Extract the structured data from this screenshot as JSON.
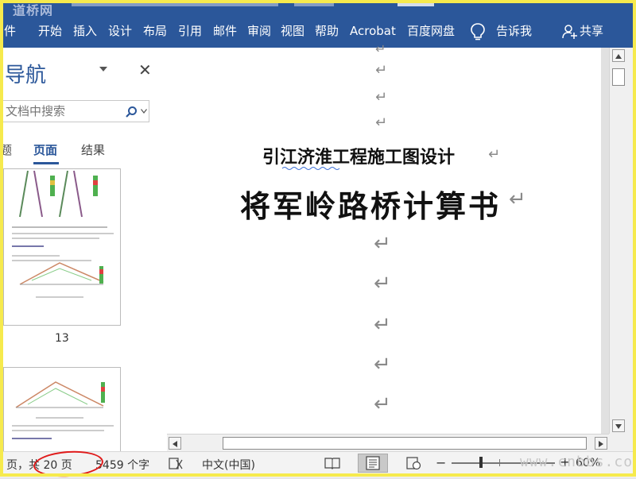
{
  "watermark": "道桥网",
  "ribbon": {
    "tabs": [
      "件",
      "开始",
      "插入",
      "设计",
      "布局",
      "引用",
      "邮件",
      "审阅",
      "视图",
      "帮助",
      "Acrobat",
      "百度网盘"
    ],
    "tell_me": "告诉我",
    "share": "共享"
  },
  "nav": {
    "title": "导航",
    "search_placeholder": "文档中搜索",
    "tabs": [
      "题",
      "页面",
      "结果"
    ],
    "active_tab": "页面",
    "page_number": "13"
  },
  "document": {
    "subtitle": "引江济淮工程施工图设计",
    "title": "将军岭路桥计算书",
    "para_mark": "↵"
  },
  "status": {
    "pages": "页，共 20 页",
    "words": "5459 个字",
    "language": "中文(中国)",
    "zoom": "60%",
    "site_watermark": "www.cnbbs.com"
  },
  "colors": {
    "ribbon": "#2b579a",
    "highlight": "#e01b1b",
    "frame": "#f6ea4d"
  }
}
